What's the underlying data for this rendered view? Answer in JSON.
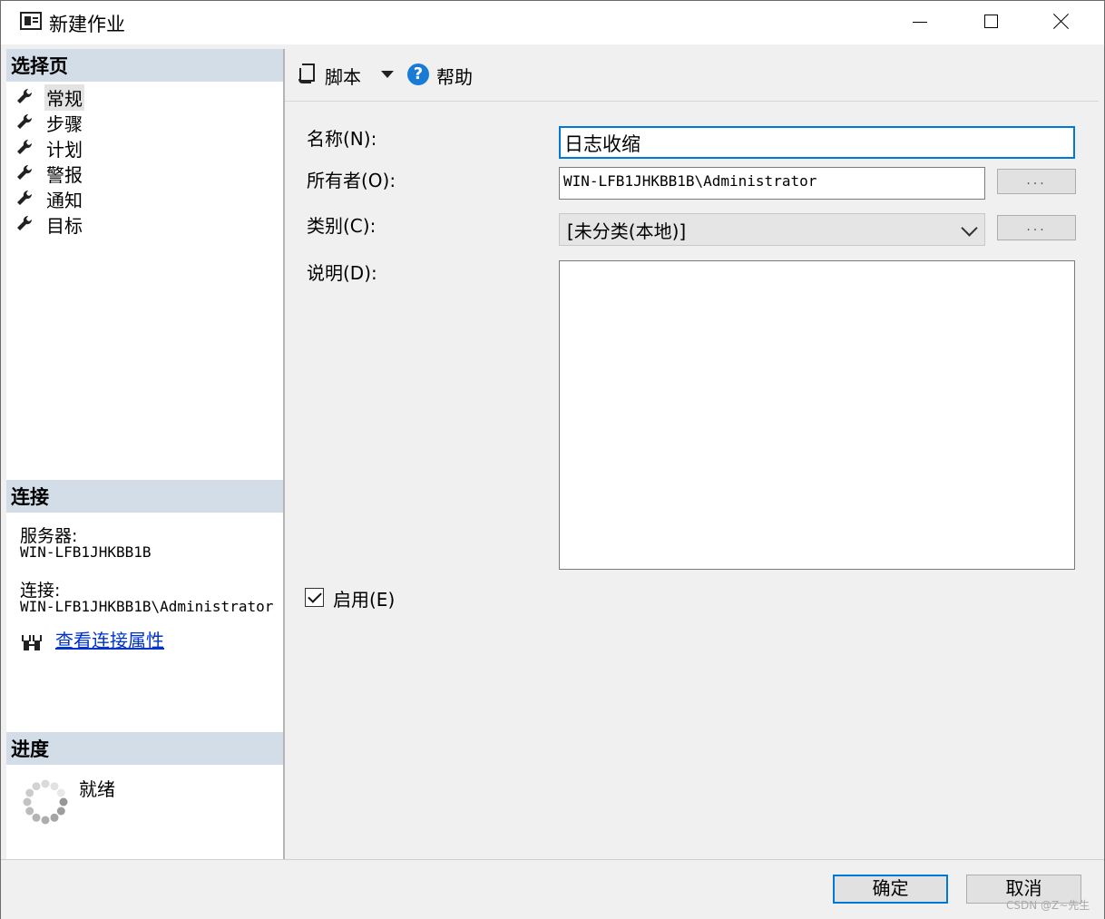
{
  "window": {
    "title": "新建作业"
  },
  "left_panel": {
    "select_page_header": "选择页",
    "nav_items": [
      {
        "label": "常规",
        "selected": true
      },
      {
        "label": "步骤"
      },
      {
        "label": "计划"
      },
      {
        "label": "警报"
      },
      {
        "label": "通知"
      },
      {
        "label": "目标"
      }
    ],
    "connection_header": "连接",
    "server_label": "服务器:",
    "server_value": "WIN-LFB1JHKBB1B",
    "connection_label": "连接:",
    "connection_value": "WIN-LFB1JHKBB1B\\Administrator",
    "view_connection_link": "查看连接属性",
    "progress_header": "进度",
    "status": "就绪"
  },
  "toolbar": {
    "script_label": "脚本",
    "help_label": "帮助"
  },
  "form": {
    "name_label": "名称(N):",
    "name_value": "日志收缩",
    "owner_label": "所有者(O):",
    "owner_value": "WIN-LFB1JHKBB1B\\Administrator",
    "browse_label": "...",
    "category_label": "类别(C):",
    "category_value": "[未分类(本地)]",
    "description_label": "说明(D):",
    "description_value": "",
    "enabled_label": "启用(E)",
    "enabled": true
  },
  "buttons": {
    "ok": "确定",
    "cancel": "取消"
  },
  "watermark": "CSDN @Z~先生",
  "colors": {
    "accent": "#0078d7",
    "section_header": "#d3dde7",
    "link": "#0033cc"
  }
}
